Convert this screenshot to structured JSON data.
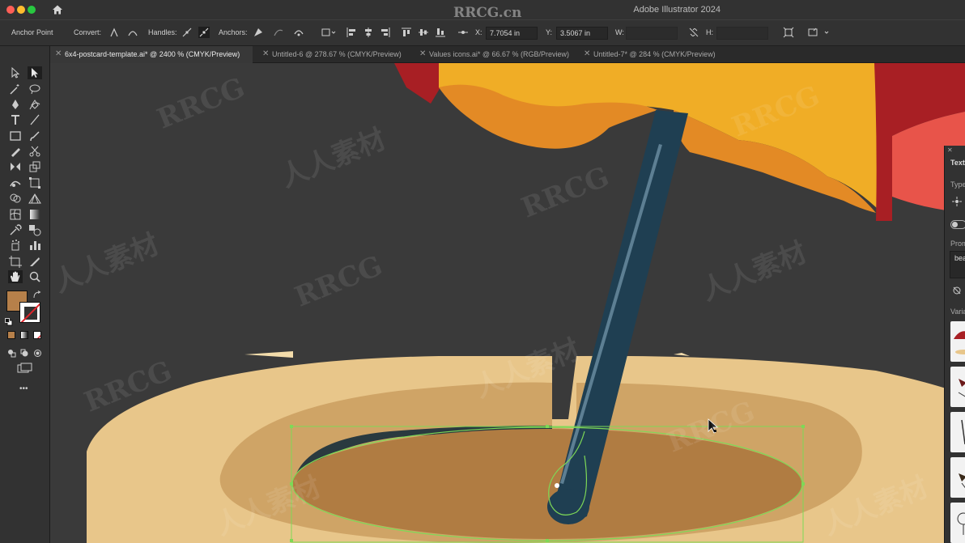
{
  "app": {
    "title": "Adobe Illustrator 2024",
    "watermark": "RRCG.cn"
  },
  "control_bar": {
    "selection_label": "Anchor Point",
    "convert_label": "Convert:",
    "handles_label": "Handles:",
    "anchors_label": "Anchors:",
    "x_label": "X:",
    "x_value": "7.7054 in",
    "y_label": "Y:",
    "y_value": "3.5067 in",
    "w_label": "W:",
    "h_label": "H:"
  },
  "tabs": [
    {
      "label": "6x4-postcard-template.ai* @ 2400 % (CMYK/Preview)",
      "active": true
    },
    {
      "label": "Untitled-6 @ 278.67 % (CMYK/Preview)",
      "active": false
    },
    {
      "label": "Values icons.ai* @ 66.67 % (RGB/Preview)",
      "active": false
    },
    {
      "label": "Untitled-7* @ 284 % (CMYK/Preview)",
      "active": false
    }
  ],
  "toolbar": {
    "more_tools": "•••",
    "fill_color": "#b6804a",
    "tools": [
      "selection-tool",
      "direct-selection-tool",
      "magic-wand-tool",
      "lasso-tool",
      "pen-tool",
      "curvature-tool",
      "type-tool",
      "line-tool",
      "rectangle-tool",
      "paintbrush-tool",
      "pencil-tool",
      "scissors-tool",
      "rotate-tool",
      "scale-tool",
      "warp-tool",
      "free-transform-tool",
      "shape-builder-tool",
      "perspective-tool",
      "mesh-tool",
      "gradient-tool",
      "eyedropper-tool",
      "blend-tool",
      "symbol-sprayer-tool",
      "column-graph-tool",
      "artboard-tool",
      "slice-tool",
      "hand-tool",
      "zoom-tool"
    ]
  },
  "right_panel": {
    "title": "Text",
    "type_label": "Type",
    "prompt_label": "Prom",
    "prompt_value": "bea",
    "variations_label": "Varia"
  },
  "colors": {
    "canvas_bg": "#3a3a3a",
    "sand_light": "#e8c68a",
    "sand_mid": "#cfa466",
    "hole": "#b07c42",
    "pole": "#1f3f52",
    "umbrella_orange": "#e38a25",
    "umbrella_yellow": "#f0ad26",
    "umbrella_red": "#a81f24",
    "umbrella_coral": "#e8544a",
    "selection": "#7ed957"
  },
  "watermark_texts": [
    "RRCG",
    "人人素材"
  ]
}
